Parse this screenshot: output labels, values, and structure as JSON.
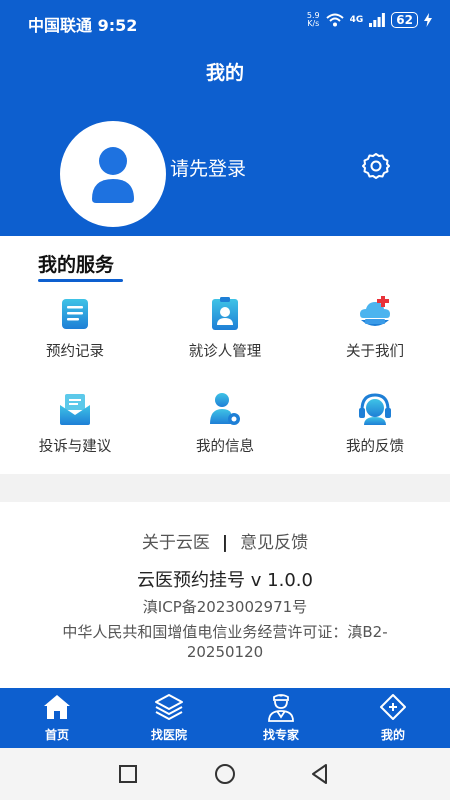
{
  "status_bar": {
    "carrier": "中国联通",
    "time": "9:52",
    "speed_top": "5.9",
    "speed_unit": "K/s",
    "network": "4G",
    "battery": "62"
  },
  "header": {
    "title": "我的",
    "login_prompt": "请先登录"
  },
  "services": {
    "title": "我的服务",
    "items": [
      {
        "label": "预约记录",
        "icon": "appointment-record-icon"
      },
      {
        "label": "就诊人管理",
        "icon": "patient-management-icon"
      },
      {
        "label": "关于我们",
        "icon": "about-us-icon"
      },
      {
        "label": "投诉与建议",
        "icon": "complaint-icon"
      },
      {
        "label": "我的信息",
        "icon": "user-info-icon"
      },
      {
        "label": "我的反馈",
        "icon": "feedback-icon"
      }
    ]
  },
  "footer": {
    "about_link": "关于云医",
    "separator": "|",
    "feedback_link": "意见反馈",
    "app_version": "云医预约挂号 v 1.0.0",
    "icp": "滇ICP备2023002971号",
    "license": "中华人民共和国增值电信业务经营许可证：滇B2-20250120"
  },
  "tabbar": {
    "tabs": [
      {
        "label": "首页"
      },
      {
        "label": "找医院"
      },
      {
        "label": "找专家"
      },
      {
        "label": "我的"
      }
    ]
  },
  "colors": {
    "primary": "#0d5fcf",
    "icon_gradient_top": "#3fc3e6",
    "icon_gradient_bottom": "#1e7fd6"
  }
}
